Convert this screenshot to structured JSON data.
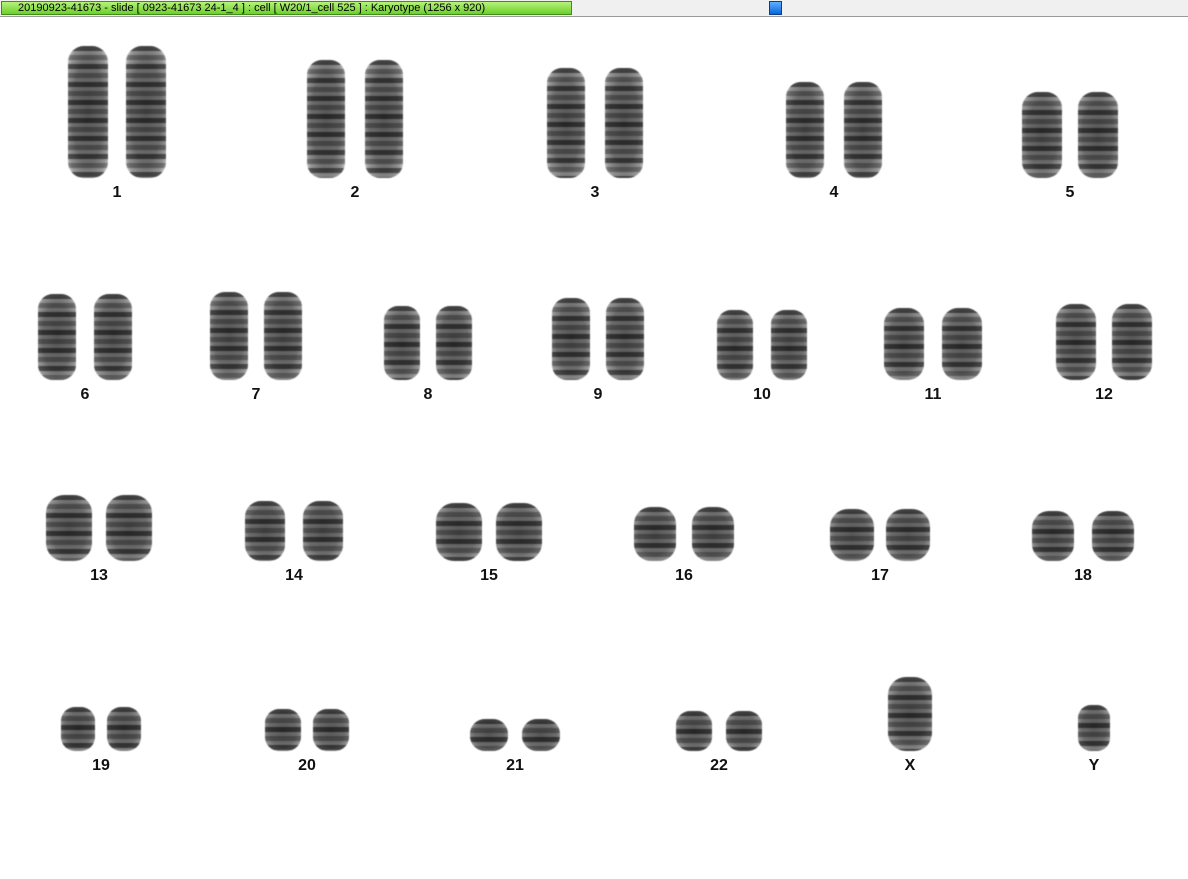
{
  "window": {
    "title": "20190923-41673 - slide [ 0923-41673 24-1_4 ] : cell [ W20/1_cell 525 ] : Karyotype  (1256 x 920)"
  },
  "colors": {
    "title_bar_green": "#7ad63a",
    "handle_blue": "#1a7be8",
    "background": "#ffffff"
  },
  "karyotype": {
    "labels": [
      "1",
      "2",
      "3",
      "4",
      "5",
      "6",
      "7",
      "8",
      "9",
      "10",
      "11",
      "12",
      "13",
      "14",
      "15",
      "16",
      "17",
      "18",
      "19",
      "20",
      "21",
      "22",
      "X",
      "Y"
    ]
  }
}
